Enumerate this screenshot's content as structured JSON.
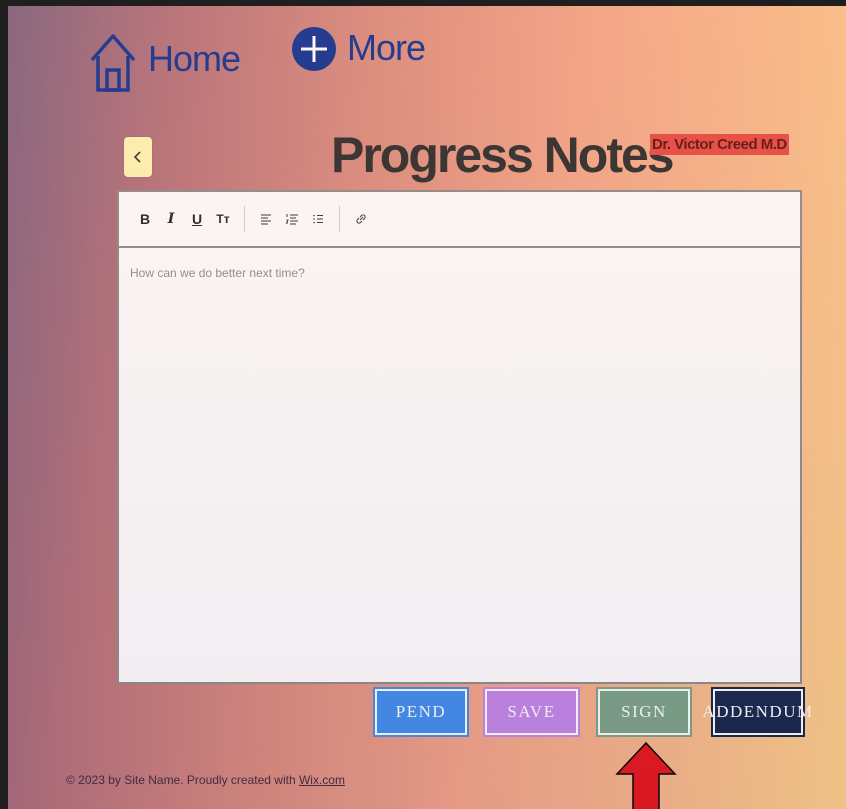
{
  "nav": {
    "home_label": "Home",
    "more_label": "More"
  },
  "header": {
    "title": "Progress Notes",
    "back_label": "‹",
    "doctor_name": "Dr. Victor Creed M.D"
  },
  "editor": {
    "toolbar": {
      "bold": "B",
      "italic": "I",
      "underline": "U",
      "text_size": "Tт"
    },
    "placeholder": "How can we do better next time?"
  },
  "actions": {
    "pend": "PEND",
    "save": "SAVE",
    "sign": "SIGN",
    "addendum": "ADDENDUM"
  },
  "footer": {
    "text": "© 2023 by Site Name. Proudly created with ",
    "link": "Wix.com"
  },
  "colors": {
    "nav_blue": "#0e2f8f",
    "pend": "#3d8ff0",
    "save": "#c386ea",
    "sign": "#7aa387",
    "addendum": "#122449",
    "doctor_badge": "#e8483f",
    "arrow": "#e8141a"
  },
  "icons": {
    "home": "home-icon",
    "more": "plus-circle-icon",
    "back": "chevron-left-icon",
    "align": "align-left-icon",
    "ordered_list": "ordered-list-icon",
    "bullet_list": "bullet-list-icon",
    "link": "link-icon",
    "pointer": "red-arrow-up-icon"
  }
}
